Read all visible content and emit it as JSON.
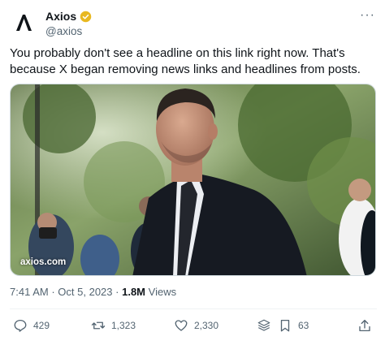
{
  "account": {
    "display_name": "Axios",
    "handle": "@axios",
    "avatar_icon": "axios-logo",
    "verified_badge_color": "#e8b820"
  },
  "tweet": {
    "text": "You probably don't see a headline on this link right now. That's because X began removing news links and headlines from posts.",
    "media_domain": "axios.com"
  },
  "meta": {
    "time": "7:41 AM",
    "separator": "·",
    "date": "Oct 5, 2023",
    "views_count": "1.8M",
    "views_label": "Views"
  },
  "actions": {
    "replies": "429",
    "reposts": "1,323",
    "likes": "2,330",
    "bookmarks": "63"
  },
  "more_label": "···"
}
